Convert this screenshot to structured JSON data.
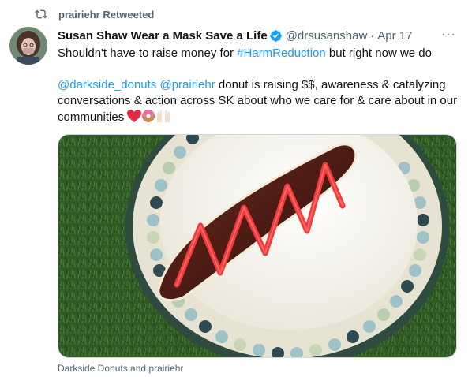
{
  "retweet": {
    "label": "prairiehr Retweeted"
  },
  "tweet": {
    "display_name": "Susan Shaw Wear a Mask Save a Life",
    "handle": "@drsusanshaw",
    "separator": "·",
    "time": "Apr 17",
    "more": "···",
    "line1_pre": "Shouldn't have to raise money for ",
    "line1_hashtag": "#HarmReduction",
    "line1_post": " but right now we do",
    "mention1": "@darkside_donuts",
    "mention2": "@prairiehr",
    "line2_rest": " donut is raising $$, awareness & catalyzing conversations & action across SK about who we care for & care about in our communities ",
    "media_caption": "Darkside Donuts and prairiehr"
  },
  "colors": {
    "link": "#1d9bf0",
    "muted": "#536471",
    "verified": "#1d9bf0"
  },
  "icons": [
    "retweet-icon",
    "verified-badge-icon",
    "more-icon",
    "heart-emoji-icon",
    "donut-emoji-icon",
    "raised-hands-emoji-icon"
  ]
}
